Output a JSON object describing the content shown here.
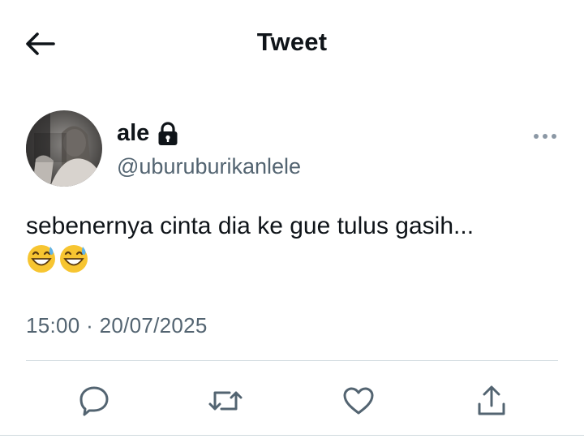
{
  "header": {
    "title": "Tweet",
    "back_icon": "arrow-left-icon"
  },
  "author": {
    "name": "ale",
    "handle": "@uburuburikanlele",
    "protected_icon": "lock-icon",
    "avatar_icon": "avatar-photo",
    "more_icon": "more-horizontal-icon"
  },
  "tweet": {
    "text": "sebenernya cinta dia ke gue tulus gasih...",
    "emojis": [
      "grinning-face-with-sweat",
      "grinning-face-with-sweat"
    ],
    "timestamp": "15:00 · 20/07/2025"
  },
  "actions": [
    {
      "name": "reply",
      "icon": "reply-icon"
    },
    {
      "name": "retweet",
      "icon": "retweet-icon"
    },
    {
      "name": "like",
      "icon": "heart-icon"
    },
    {
      "name": "share",
      "icon": "share-icon"
    }
  ],
  "colors": {
    "text": "#0f1419",
    "secondary": "#536471",
    "divider": "#cfd9de"
  }
}
